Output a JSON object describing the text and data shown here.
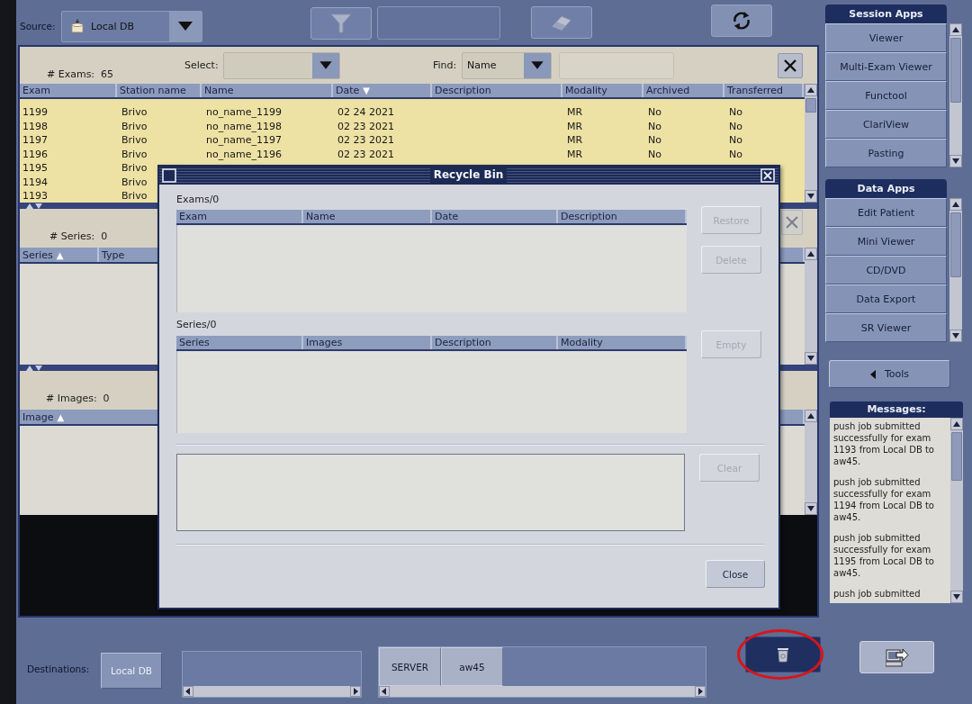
{
  "toolbar": {
    "source_label": "Source:",
    "source": "Local DB"
  },
  "exams": {
    "count_label": "# Exams:",
    "count": "65",
    "select_label": "Select:",
    "find_label": "Find:",
    "find_by": "Name",
    "columns": [
      {
        "label": "Exam"
      },
      {
        "label": "Station name"
      },
      {
        "label": "Name"
      },
      {
        "label": "Date",
        "sort_mark": "▼"
      },
      {
        "label": "Description"
      },
      {
        "label": "Modality"
      },
      {
        "label": "Archived"
      },
      {
        "label": "Transferred"
      }
    ],
    "rows": [
      {
        "exam": "1199",
        "station_name": "Brivo",
        "name": "no_name_1199",
        "date": "02 24 2021",
        "modality": "MR",
        "archived": "No",
        "transferred": "No"
      },
      {
        "exam": "1198",
        "station_name": "Brivo",
        "name": "no_name_1198",
        "date": "02 23 2021",
        "modality": "MR",
        "archived": "No",
        "transferred": "No"
      },
      {
        "exam": "1197",
        "station_name": "Brivo",
        "name": "no_name_1197",
        "date": "02 23 2021",
        "modality": "MR",
        "archived": "No",
        "transferred": "No"
      },
      {
        "exam": "1196",
        "station_name": "Brivo",
        "name": "no_name_1196",
        "date": "02 23 2021",
        "modality": "MR",
        "archived": "No",
        "transferred": "No"
      },
      {
        "exam": "1195",
        "station_name": "Brivo"
      },
      {
        "exam": "1194",
        "station_name": "Brivo"
      },
      {
        "exam": "1193",
        "station_name": "Brivo"
      }
    ]
  },
  "series": {
    "count_label": "# Series:",
    "count": "0",
    "columns": [
      {
        "label": "Series",
        "sort_mark": "▲"
      },
      {
        "label": "Type"
      }
    ]
  },
  "images": {
    "count_label": "# Images:",
    "count": "0",
    "columns": [
      {
        "label": "Image",
        "sort_mark": "▲"
      }
    ]
  },
  "sidebar": {
    "groups": [
      {
        "title": "Session Apps",
        "items": [
          "Viewer",
          "Multi-Exam Viewer",
          "Functool",
          "ClariView",
          "Pasting"
        ]
      },
      {
        "title": "Data Apps",
        "items": [
          "Edit Patient",
          "Mini Viewer",
          "CD/DVD",
          "Data Export",
          "SR Viewer"
        ]
      }
    ],
    "tools_button": "Tools",
    "messages": {
      "title": "Messages:",
      "items": [
        "push job submitted successfully for exam 1193 from Local DB to aw45.",
        "push job submitted successfully for exam 1194 from Local DB to aw45.",
        "push job submitted successfully for exam 1195 from Local DB to aw45.",
        "push job submitted"
      ]
    }
  },
  "bottom": {
    "destinations_label": "Destinations:",
    "local_button": "Local DB",
    "network_items": [
      "SERVER",
      "aw45"
    ],
    "recycle_bin_button": {
      "active": true,
      "circled": true
    }
  },
  "dialog": {
    "title": "Recycle Bin",
    "sections": [
      {
        "label": "Exams/0",
        "columns": [
          "Exam",
          "Name",
          "Date",
          "Description"
        ],
        "buttons": [
          {
            "label": "Restore",
            "disabled": true
          },
          {
            "label": "Delete",
            "disabled": true
          }
        ]
      },
      {
        "label": "Series/0",
        "columns": [
          "Series",
          "Images",
          "Description",
          "Modality"
        ],
        "buttons": [
          {
            "label": "Empty",
            "disabled": true
          }
        ]
      }
    ],
    "log_buttons": [
      {
        "label": "Clear",
        "disabled": true
      }
    ],
    "close_button": {
      "label": "Close",
      "disabled": false
    }
  }
}
